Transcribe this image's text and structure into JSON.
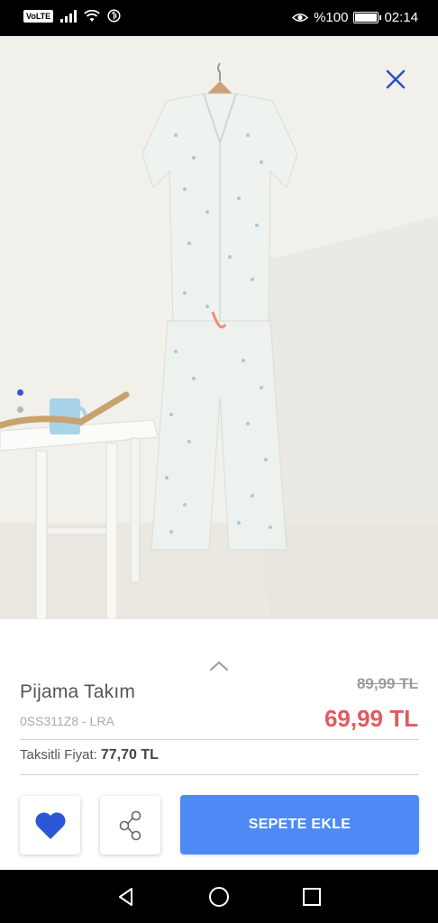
{
  "status_bar": {
    "network_badge": "VoLTE",
    "battery_text": "%100",
    "time": "02:14",
    "icons": [
      "signal-icon",
      "wifi-icon",
      "data-saver-icon",
      "eye-comfort-icon",
      "battery-icon"
    ]
  },
  "gallery": {
    "image": "pajama-set-product-photo",
    "page_count": 2,
    "current_page": 1
  },
  "product": {
    "name": "Pijama Takım",
    "sku": "0SS311Z8 - LRA",
    "old_price": "89,99 TL",
    "new_price": "69,99 TL",
    "installment_label": "Taksitli Fiyat:",
    "installment_value": "77,70 TL"
  },
  "actions": {
    "add_to_cart_label": "SEPETE EKLE"
  },
  "colors": {
    "accent_blue": "#4d8af5",
    "favorite_blue": "#2b57d6",
    "price_red": "#e05b5f",
    "close_blue": "#2b50c8"
  }
}
